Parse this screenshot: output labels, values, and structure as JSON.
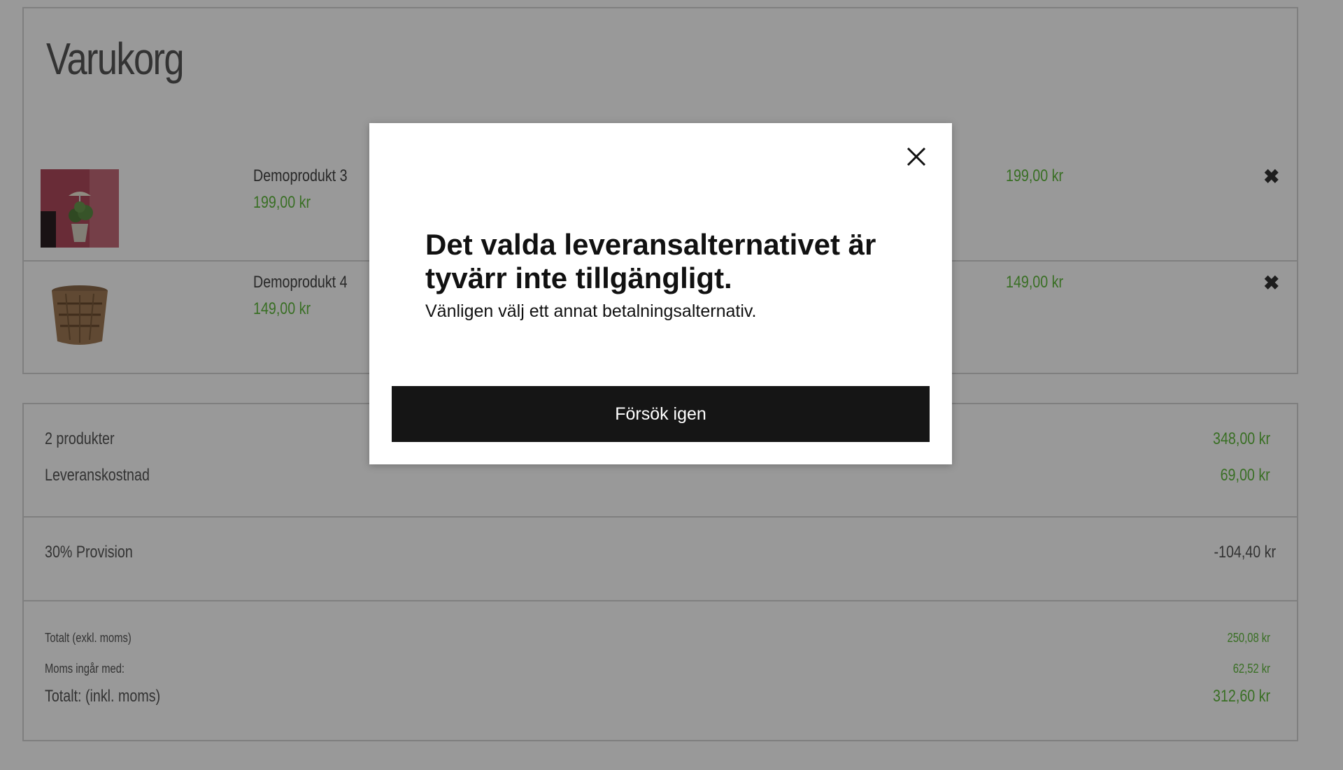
{
  "cart": {
    "title": "Varukorg",
    "items": [
      {
        "name": "Demoprodukt 3",
        "price": "199,00 kr",
        "total": "199,00 kr",
        "remove_icon": "close-x-icon"
      },
      {
        "name": "Demoprodukt 4",
        "price": "149,00 kr",
        "total": "149,00 kr",
        "remove_icon": "close-x-icon"
      }
    ]
  },
  "summary": {
    "products_label": "2 produkter",
    "products_value": "348,00 kr",
    "shipping_label": "Leveranskostnad",
    "shipping_value": "69,00 kr",
    "commission_label": "30% Provision",
    "commission_value": "-104,40 kr",
    "excl_vat_label": "Totalt (exkl. moms)",
    "excl_vat_value": "250,08 kr",
    "vat_label": "Moms ingår med:",
    "vat_value": "62,52 kr",
    "total_label": "Totalt: (inkl. moms)",
    "total_value": "312,60 kr"
  },
  "modal": {
    "heading": "Det valda leveransalternativet är tyvärr inte tillgängligt.",
    "text": "Vänligen välj ett annat betalningsalternativ.",
    "button_label": "Försök igen",
    "close_icon": "close-icon"
  },
  "colors": {
    "price_green": "#5fb93c",
    "overlay": "rgba(0,0,0,0.4)",
    "button_bg": "#151515"
  }
}
